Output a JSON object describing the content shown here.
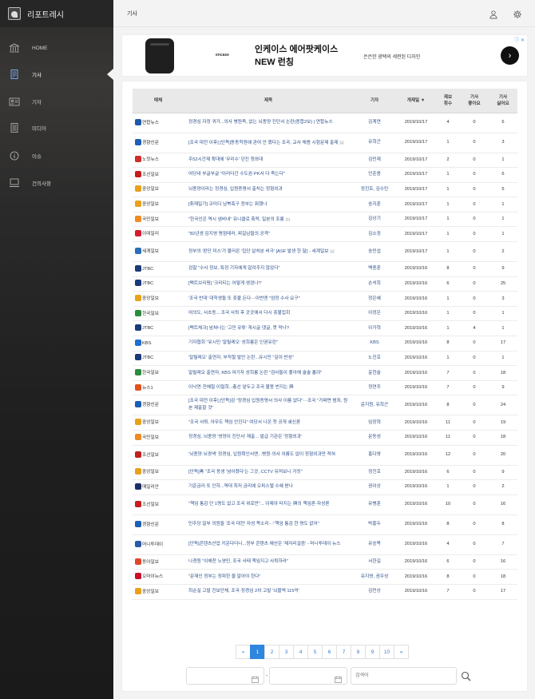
{
  "app": {
    "name": "리포트레시"
  },
  "nav": [
    {
      "label": "HOME",
      "icon": "bank-icon"
    },
    {
      "label": "기사",
      "icon": "document-icon"
    },
    {
      "label": "기자",
      "icon": "id-card-icon"
    },
    {
      "label": "미디어",
      "icon": "media-icon"
    },
    {
      "label": "이슈",
      "icon": "info-icon"
    },
    {
      "label": "건의사항",
      "icon": "computer-icon"
    }
  ],
  "active_nav": "기사",
  "topbar": {
    "title": "기사",
    "user_icon": "user-icon",
    "settings_icon": "gear-icon"
  },
  "ad": {
    "brand": "encase",
    "headline1": "인케이스 에어팟케이스",
    "headline2": "NEW 런칭",
    "sub": "은은한 광택의 세련된 디자인",
    "go": "›",
    "icons": "ⓘ ✕"
  },
  "table": {
    "headers": {
      "media": "매체",
      "title": "제목",
      "reporter": "기자",
      "date": "게재일 ▼",
      "reports": "제보\n횟수",
      "likes": "기사\n좋아요",
      "dislikes": "기사\n싫어요"
    },
    "rows": [
      {
        "media": "연합뉴스",
        "color": "#1e5aa8",
        "title": "정경심 자정 귀가...의사 병원측, 없는 뇌종양 진단서 논란(종합2보) | 연합뉴스",
        "c": "",
        "reporter": "김계연",
        "date": "2019/10/17",
        "reports": "4",
        "likes": "0",
        "dislikes": "6"
      },
      {
        "media": "경향신문",
        "color": "#1d5fb3",
        "title": "[조국 대전 이후] [단독]동동학원에 관여 안 했다는 조국, 교사 채용 시험문제 출제",
        "c": "[1]",
        "reporter": "유희곤",
        "date": "2019/10/17",
        "reports": "1",
        "likes": "0",
        "dislikes": "3"
      },
      {
        "media": "노컷뉴스",
        "color": "#d12b2b",
        "title": "주52시간제 확대에 '무리수' 던진 청와대",
        "c": "",
        "reporter": "김민재",
        "date": "2019/10/17",
        "reports": "2",
        "likes": "0",
        "dislikes": "1"
      },
      {
        "media": "조선일보",
        "color": "#c41e1e",
        "title": "여당내 부글부글 \"이러다간 수도권·PK서 다 죽는다\"",
        "c": "",
        "reporter": "안준용",
        "date": "2019/10/17",
        "reports": "1",
        "likes": "0",
        "dislikes": "6"
      },
      {
        "media": "중앙일보",
        "color": "#e8a21a",
        "title": "뇌종양이라는 정경심, 입원증명서 출처는 정형외과",
        "c": "",
        "reporter": "정진호, 김수민",
        "date": "2019/10/17",
        "reports": "1",
        "likes": "0",
        "dislikes": "5"
      },
      {
        "media": "중앙일보",
        "color": "#e8a21a",
        "title": "[취재일기] 코미디 남북축구 정부는 뭐했나",
        "c": "",
        "reporter": "송지훈",
        "date": "2019/10/17",
        "reports": "1",
        "likes": "0",
        "dislikes": "1"
      },
      {
        "media": "국민일보",
        "color": "#f08a24",
        "title": "\"한국인은 역시 냄비네\" 유니클로 폭락, 일본의 조롱",
        "c": "[1]",
        "reporter": "김상기",
        "date": "2019/10/17",
        "reports": "1",
        "likes": "0",
        "dislikes": "1"
      },
      {
        "media": "이데일리",
        "color": "#d61c2e",
        "title": "\"82년생 김지영 평점테러, 찌질남들의 공격\"",
        "c": "",
        "reporter": "김소정",
        "date": "2019/10/17",
        "reports": "1",
        "likes": "0",
        "dislikes": "1"
      },
      {
        "media": "세계일보",
        "color": "#2a6fb8",
        "title": "정부의 '판단 미스'가 불러온 '집단 살처분 비극' [ASF 발생 한 달] - 세계일보",
        "c": "[1]",
        "reporter": "송민섭",
        "date": "2019/10/17",
        "reports": "1",
        "likes": "0",
        "dislikes": "2"
      },
      {
        "media": "JTBC",
        "color": "#1a3a7a",
        "title": "검찰 \"수사 정보, 특정 기자에게 알려주지 않았다\"",
        "c": "",
        "reporter": "백종훈",
        "date": "2019/10/16",
        "reports": "8",
        "likes": "0",
        "dislikes": "9"
      },
      {
        "media": "JTBC",
        "color": "#1a3a7a",
        "title": "[팩트브리핑] '크리티는 어떻게 생겼나?'",
        "c": "",
        "reporter": "손석희",
        "date": "2019/10/16",
        "reports": "6",
        "likes": "0",
        "dislikes": "25"
      },
      {
        "media": "중앙일보",
        "color": "#e8a21a",
        "title": "'조국 반대' 대학생들 또 촛불 든다···이번엔 \"엄정 수사 요구\"",
        "c": "",
        "reporter": "정은혜",
        "date": "2019/10/16",
        "reports": "1",
        "likes": "0",
        "dislikes": "3"
      },
      {
        "media": "한국일보",
        "color": "#2c8c3c",
        "title": "여의도, 서초동... 조국 사퇴 후 곳곳에서 다시 촛불집회",
        "c": "",
        "reporter": "이정은",
        "date": "2019/10/16",
        "reports": "1",
        "likes": "0",
        "dislikes": "1"
      },
      {
        "media": "JTBC",
        "color": "#1a3a7a",
        "title": "[팩트체크] 넘쳐나는 '고민 유튜' 게시글·댓글, 못 막나?",
        "c": "",
        "reporter": "이가혁",
        "date": "2019/10/16",
        "reports": "1",
        "likes": "4",
        "dislikes": "1"
      },
      {
        "media": "KBS",
        "color": "#1e6fd0",
        "title": "기자협회 \"유시민 '알릴레오' 성희롱은 인권유린\"",
        "c": "",
        "reporter": "KBS",
        "date": "2019/10/16",
        "reports": "8",
        "likes": "0",
        "dislikes": "17"
      },
      {
        "media": "JTBC",
        "color": "#1a3a7a",
        "title": "'알릴레오' 출연자, 부적절 발언 논란...유시민 \"깊이 반성\"",
        "c": "",
        "reporter": "노진호",
        "date": "2019/10/16",
        "reports": "1",
        "likes": "0",
        "dislikes": "1"
      },
      {
        "media": "한국일보",
        "color": "#2c8c3c",
        "title": "알릴레오 출연자, KBS 여기자 성희롱 논란 \"검사들이 좋아해 술술 흘려\"",
        "c": "",
        "reporter": "윤한슬",
        "date": "2019/10/16",
        "reports": "7",
        "likes": "0",
        "dislikes": "18"
      },
      {
        "media": "뉴스1",
        "color": "#e0531e",
        "title": "이낙연·전해철 이철희...총선 앞두고 조국 불똥 번지는 與",
        "c": "",
        "reporter": "정연주",
        "date": "2019/10/16",
        "reports": "7",
        "likes": "0",
        "dislikes": "9"
      },
      {
        "media": "경향신문",
        "color": "#1d5fb3",
        "title": "[조국 대전 이후] [단독]검 \"정경심 입원증명서 의사 이름 없다\"···조국 \"가짜면 범죄, 원본 제출할 것\"",
        "c": "",
        "reporter": "윤지원, 유희곤",
        "date": "2019/10/16",
        "reports": "8",
        "likes": "0",
        "dislikes": "24"
      },
      {
        "media": "중앙일보",
        "color": "#e8a21a",
        "title": "\"조국 사퇴, 아무도 책임 안진다\" 여당서 나온 첫 공개 쇄신론",
        "c": "",
        "reporter": "임장혁",
        "date": "2019/10/16",
        "reports": "11",
        "likes": "0",
        "dislikes": "19"
      },
      {
        "media": "국민일보",
        "color": "#f08a24",
        "title": "정경심, 뇌종양 '영양이 진단서' 제출... 발급 기관은 '정형외과'",
        "c": "",
        "reporter": "문동성",
        "date": "2019/10/16",
        "reports": "11",
        "likes": "0",
        "dislikes": "18"
      },
      {
        "media": "조선일보",
        "color": "#c41e1e",
        "title": "'뇌종양·뇌경색' 정경심, 입원확인서엔...병원·의사 이름도 없이 정형외과만 적혀",
        "c": "",
        "reporter": "홍다영",
        "date": "2019/10/16",
        "reports": "12",
        "likes": "0",
        "dislikes": "20"
      },
      {
        "media": "중앙일보",
        "color": "#e8a21a",
        "title": "[단독]靑 \"조국 동생 '넘어졌다'는 그곳, CCTV 뒤져보니 거짓\"",
        "c": "",
        "reporter": "정진호",
        "date": "2019/10/16",
        "reports": "6",
        "likes": "0",
        "dislikes": "9"
      },
      {
        "media": "매일리안",
        "color": "#1b2f6b",
        "title": "기준금리 또 인하...역대 최저 금리에 오피스텔 수혜 받나",
        "c": "",
        "reporter": "권이상",
        "date": "2019/10/16",
        "reports": "1",
        "likes": "0",
        "dislikes": "2"
      },
      {
        "media": "조선일보",
        "color": "#c41e1e",
        "title": "\"책임 통감 단 1명도 없고 조국 위로만\"... 이제야 터지는 與의 책임론·자성론",
        "c": "",
        "reporter": "유병훈",
        "date": "2019/10/16",
        "reports": "10",
        "likes": "0",
        "dislikes": "16"
      },
      {
        "media": "경향신문",
        "color": "#1d5fb3",
        "title": "민주당 일부 의원들 '조국 대전' 자성 목소리···\"책임 통감 한 명도 없어\"",
        "c": "",
        "reporter": "박홍두",
        "date": "2019/10/16",
        "reports": "8",
        "likes": "0",
        "dislikes": "8"
      },
      {
        "media": "머니투데이",
        "color": "#2a5caa",
        "title": "[단독]콘텐츠산업 키운다더니...정부 콘텐츠 예산은 '제자리걸음' - 머니투데이 뉴스",
        "c": "",
        "reporter": "유승목",
        "date": "2019/10/16",
        "reports": "4",
        "likes": "0",
        "dislikes": "7"
      },
      {
        "media": "동아일보",
        "color": "#e0472a",
        "title": "나경원 \"이해찬 노영민, 조국 사태 책임지고 사퇴하라\"",
        "c": "",
        "reporter": "서한길",
        "date": "2019/10/16",
        "reports": "6",
        "likes": "0",
        "dislikes": "16"
      },
      {
        "media": "오마이뉴스",
        "color": "#c8102e",
        "title": "\"문재인 정부는 정피한 줄 알아야 한다\"",
        "c": "",
        "reporter": "유지영, 권우성",
        "date": "2019/10/16",
        "reports": "8",
        "likes": "0",
        "dislikes": "18"
      },
      {
        "media": "중앙일보",
        "color": "#e8a21a",
        "title": "최순실 고발 진보단체, 조국·정경심 2차 고발 '뇌물액 115억'",
        "c": "",
        "reporter": "김민상",
        "date": "2019/10/16",
        "reports": "7",
        "likes": "0",
        "dislikes": "17"
      }
    ]
  },
  "pager": {
    "prev": "«",
    "pages": [
      "1",
      "2",
      "3",
      "4",
      "5",
      "6",
      "7",
      "8",
      "9",
      "10"
    ],
    "next": "»",
    "current": "1"
  },
  "search": {
    "placeholder": "검색어",
    "calendar_icon": "calendar-icon",
    "dash": "-",
    "search_icon": "search-icon"
  }
}
